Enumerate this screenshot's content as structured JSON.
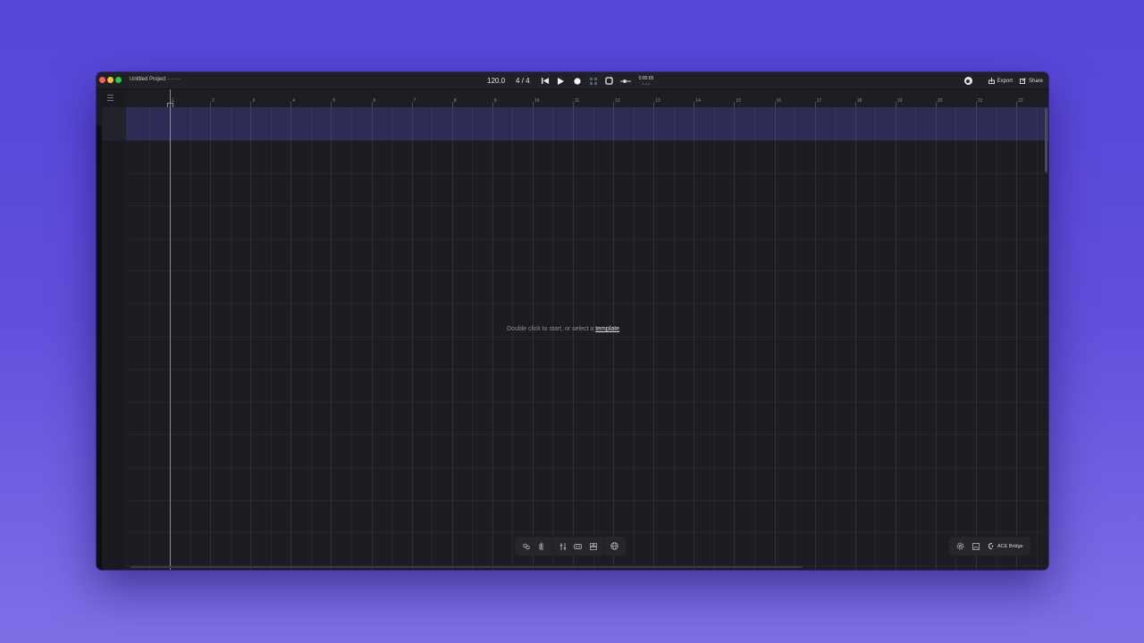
{
  "window": {
    "project_title": "Untitled Project",
    "project_status": "———"
  },
  "transport": {
    "tempo": "120.0",
    "time_signature": "4 / 4",
    "clock_time": "0:00:00",
    "clock_bars": "1.1.1"
  },
  "header_right": {
    "export_label": "Export",
    "share_label": "Share"
  },
  "ruler": {
    "bars": [
      "1",
      "2",
      "3",
      "4",
      "5",
      "6",
      "7",
      "8",
      "9",
      "10",
      "11",
      "12",
      "13",
      "14",
      "15",
      "16",
      "17",
      "18",
      "19",
      "20",
      "21",
      "22"
    ]
  },
  "canvas": {
    "hint_prefix": "Double click to start, or select a",
    "hint_link": "template"
  },
  "bottom_right": {
    "bridge_label": "ACE Bridge"
  },
  "colors": {
    "background_top": "#5546d8",
    "window_bg": "#1c1d22",
    "lane_highlight": "#2d2c56"
  }
}
